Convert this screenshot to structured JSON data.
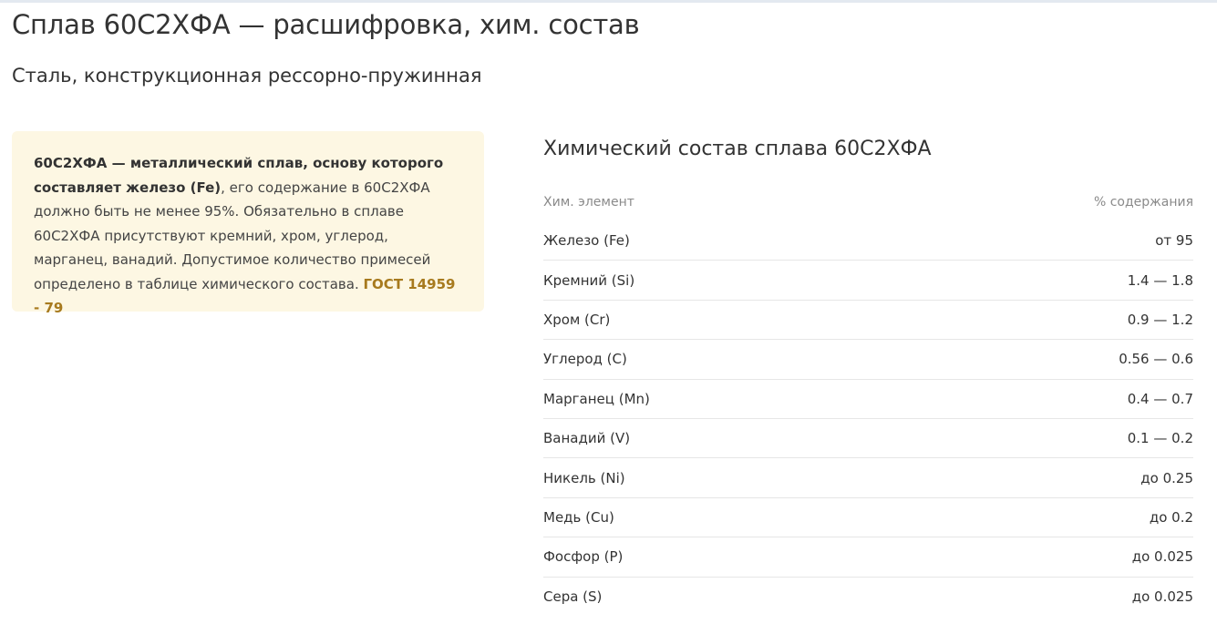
{
  "page": {
    "title": "Сплав 60С2ХФА — расшифровка, хим. состав",
    "subtitle": "Сталь, конструкционная рессорно-пружинная"
  },
  "info": {
    "bold_lead": "60С2ХФА — металлический сплав, основу которого составляет железо (Fe)",
    "text": ", его содержание в 60С2ХФА должно быть не менее 95%. Обязательно в сплаве 60С2ХФА присутствуют кремний, хром, углерод, марганец, ванадий. Допустимое количество примесей определено в таблице химического состава. ",
    "gost_link": "ГОСТ 14959 - 79"
  },
  "composition": {
    "title": "Химический состав сплава 60С2ХФА",
    "col_element": "Хим. элемент",
    "col_percent": "% содержания",
    "rows": [
      {
        "element": "Железо (Fe)",
        "value": "от 95"
      },
      {
        "element": "Кремний (Si)",
        "value": "1.4 — 1.8"
      },
      {
        "element": "Хром (Cr)",
        "value": "0.9 — 1.2"
      },
      {
        "element": "Углерод (C)",
        "value": "0.56 — 0.6"
      },
      {
        "element": "Марганец (Mn)",
        "value": "0.4 — 0.7"
      },
      {
        "element": "Ванадий (V)",
        "value": "0.1 — 0.2"
      },
      {
        "element": "Никель (Ni)",
        "value": "до 0.25"
      },
      {
        "element": "Медь (Cu)",
        "value": "до 0.2"
      },
      {
        "element": "Фосфор (P)",
        "value": "до 0.025"
      },
      {
        "element": "Сера (S)",
        "value": "до 0.025"
      }
    ]
  }
}
